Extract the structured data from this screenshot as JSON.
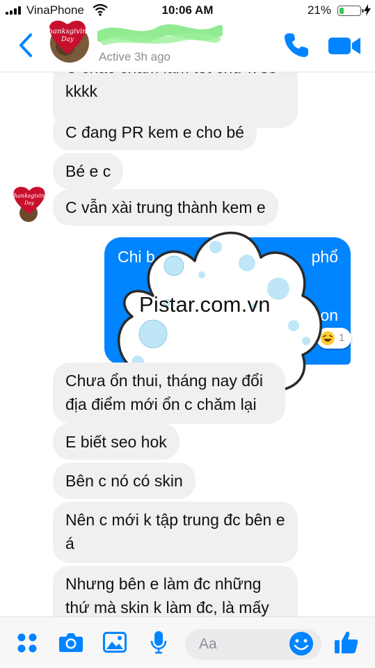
{
  "status_bar": {
    "carrier": "VinaPhone",
    "time": "10:06 AM",
    "battery_percent": "21%",
    "battery_level": 0.21
  },
  "header": {
    "avatar_caption": "Thanksgiving Day",
    "contact_name": "",
    "active_status": "Active 3h ago"
  },
  "messages": [
    {
      "side": "received",
      "text": "C chắc chăm làm tốt chứ k sẽ"
    },
    {
      "side": "received",
      "text": "kkkk"
    },
    {
      "side": "received",
      "text": "C đang PR kem e cho bé"
    },
    {
      "side": "received",
      "text": "Bé e c"
    },
    {
      "side": "received",
      "text": "C vẫn xài trung thành kem e"
    },
    {
      "side": "sent",
      "text": "Chi b"
    },
    {
      "side": "sent",
      "text": "phổ"
    },
    {
      "side": "sent",
      "text": "on"
    },
    {
      "side": "received",
      "text": "Chưa ổn thui, tháng nay đổi địa điểm mới ổn c chăm lại"
    },
    {
      "side": "received",
      "text": "E biết seo hok"
    },
    {
      "side": "received",
      "text": "Bên c nó có skin"
    },
    {
      "side": "received",
      "text": "Nên c mới k tập trung đc bên e á"
    },
    {
      "side": "received",
      "text": "Nhưng bên e làm đc những thứ mà skin k làm đc, là mấy"
    }
  ],
  "reaction": {
    "emoji": "laughing-emoji",
    "count": "1"
  },
  "watermark": {
    "text": "Pistar.com.vn"
  },
  "composer": {
    "placeholder": "Aa"
  },
  "colors": {
    "accent": "#0084ff",
    "received_bubble": "#f1f0f0",
    "battery": "#35c759",
    "name_scribble": "#7ee87e"
  }
}
